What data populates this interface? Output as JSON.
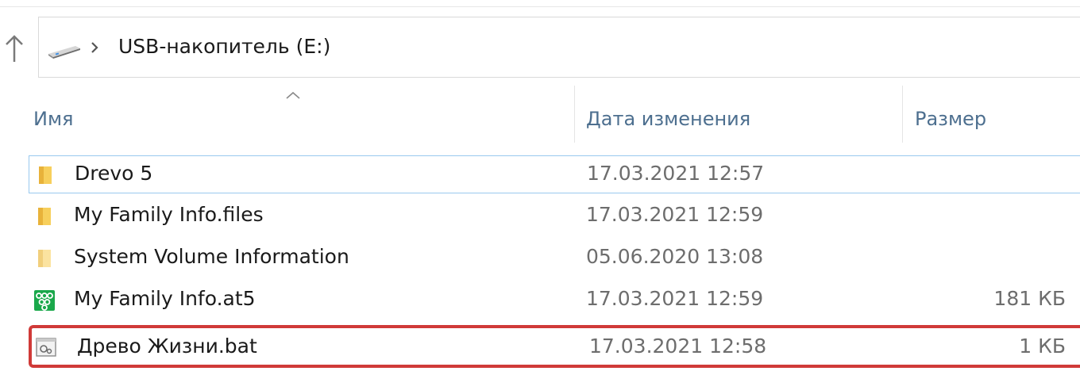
{
  "navigation": {
    "up_icon": "up-arrow-icon",
    "breadcrumb": {
      "drive_icon": "usb-drive-icon",
      "separator_icon": "chevron-right-icon",
      "location": "USB-накопитель (E:)"
    }
  },
  "columns": {
    "name": "Имя",
    "date_modified": "Дата изменения",
    "size": "Размер",
    "sort_icon": "sort-ascending-icon"
  },
  "files": [
    {
      "name": "Drevo 5",
      "date": "17.03.2021 12:57",
      "size": "",
      "icon": "folder-icon"
    },
    {
      "name": "My Family Info.files",
      "date": "17.03.2021 12:59",
      "size": "",
      "icon": "folder-icon"
    },
    {
      "name": "System Volume Information",
      "date": "05.06.2020 13:08",
      "size": "",
      "icon": "folder-icon"
    },
    {
      "name": "My Family Info.at5",
      "date": "17.03.2021 12:59",
      "size": "181 КБ",
      "icon": "family-tree-icon"
    },
    {
      "name": "Древо Жизни.bat",
      "date": "17.03.2021 12:58",
      "size": "1 КБ",
      "icon": "batch-file-icon"
    }
  ],
  "colors": {
    "header_text": "#4d6f8f",
    "highlight": "#d03a38",
    "focus_border": "#99c9ef",
    "folder": "#f5c443"
  }
}
